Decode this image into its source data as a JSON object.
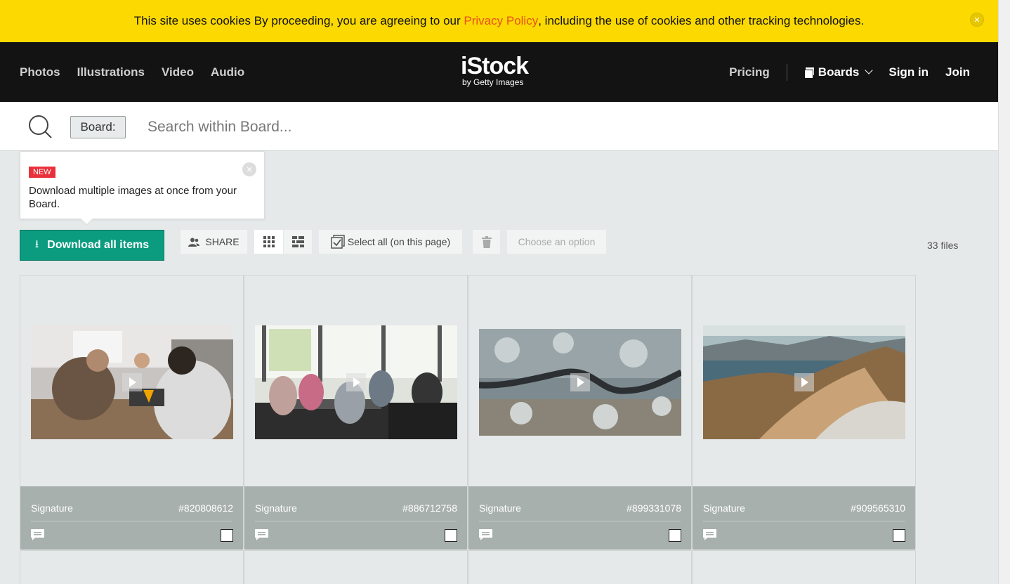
{
  "cookie_banner": {
    "text_before": "This site uses cookies By proceeding, you are agreeing to our ",
    "link": "Privacy Policy",
    "text_after": ", including the use of cookies and other tracking technologies."
  },
  "nav": {
    "left": [
      "Photos",
      "Illustrations",
      "Video",
      "Audio"
    ],
    "logo_main": "iStock",
    "logo_sub": "by Getty Images",
    "pricing": "Pricing",
    "boards": "Boards",
    "signin": "Sign in",
    "join": "Join"
  },
  "search": {
    "chip": "Board:",
    "placeholder": "Search within Board..."
  },
  "tooltip": {
    "badge": "NEW",
    "text": "Download multiple images at once from your Board."
  },
  "toolbar": {
    "download": "Download all items",
    "share": "SHARE",
    "select_all": "Select all (on this page)",
    "choose": "Choose an option",
    "files_count": "33 files"
  },
  "cards": [
    {
      "collection": "Signature",
      "id": "#820808612",
      "scene": "office-highfive"
    },
    {
      "collection": "Signature",
      "id": "#886712758",
      "scene": "meeting"
    },
    {
      "collection": "Signature",
      "id": "#899331078",
      "scene": "snowy-road"
    },
    {
      "collection": "Signature",
      "id": "#909565310",
      "scene": "mountains"
    }
  ],
  "colors": {
    "banner": "#fcd900",
    "link": "#e8501a",
    "header": "#131313",
    "primary_button": "#0b9c80",
    "card_footer": "#a8b0ae",
    "badge_new": "#e8313a"
  }
}
